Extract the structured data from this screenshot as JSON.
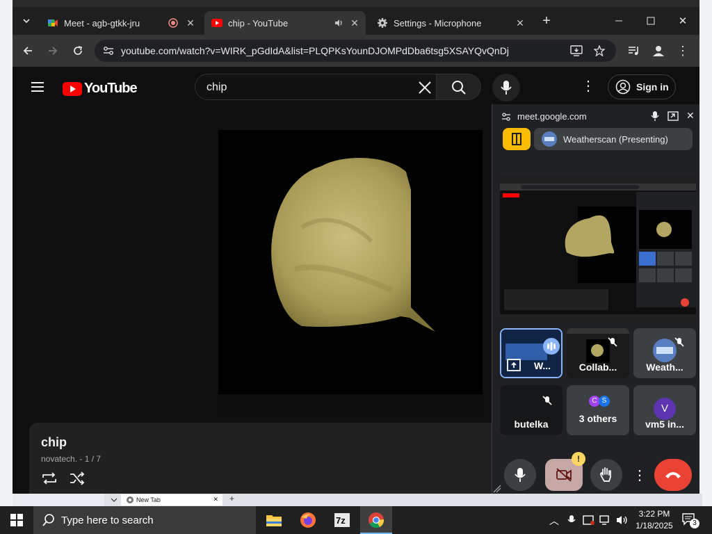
{
  "browser": {
    "tabs": [
      {
        "title": "Meet - agb-gtkk-jru"
      },
      {
        "title": "chip - YouTube"
      },
      {
        "title": "Settings - Microphone"
      }
    ],
    "url": "youtube.com/watch?v=WIRK_pGdIdA&list=PLQPKsYounDJOMPdDba6tsg5XSAYQvQnDj"
  },
  "youtube": {
    "logo_text": "YouTube",
    "search_value": "chip",
    "signin_label": "Sign in",
    "playlist": {
      "title": "chip",
      "subtitle": "novatech. - 1 / 7"
    }
  },
  "meet": {
    "origin": "meet.google.com",
    "presenting_label": "Weatherscan (Presenting)",
    "participants": [
      {
        "name": "W..."
      },
      {
        "name": "Collab..."
      },
      {
        "name": "Weath..."
      },
      {
        "name": "butelka"
      },
      {
        "name": "3 others",
        "avatars": [
          "C",
          "S"
        ]
      },
      {
        "name": "vm5 in...",
        "avatar": "V"
      }
    ],
    "camera_warning": "!"
  },
  "bottom_tab": {
    "title": "New Tab"
  },
  "taskbar": {
    "search_placeholder": "Type here to search",
    "time": "3:22 PM",
    "date": "1/18/2025",
    "notification_count": "3"
  }
}
